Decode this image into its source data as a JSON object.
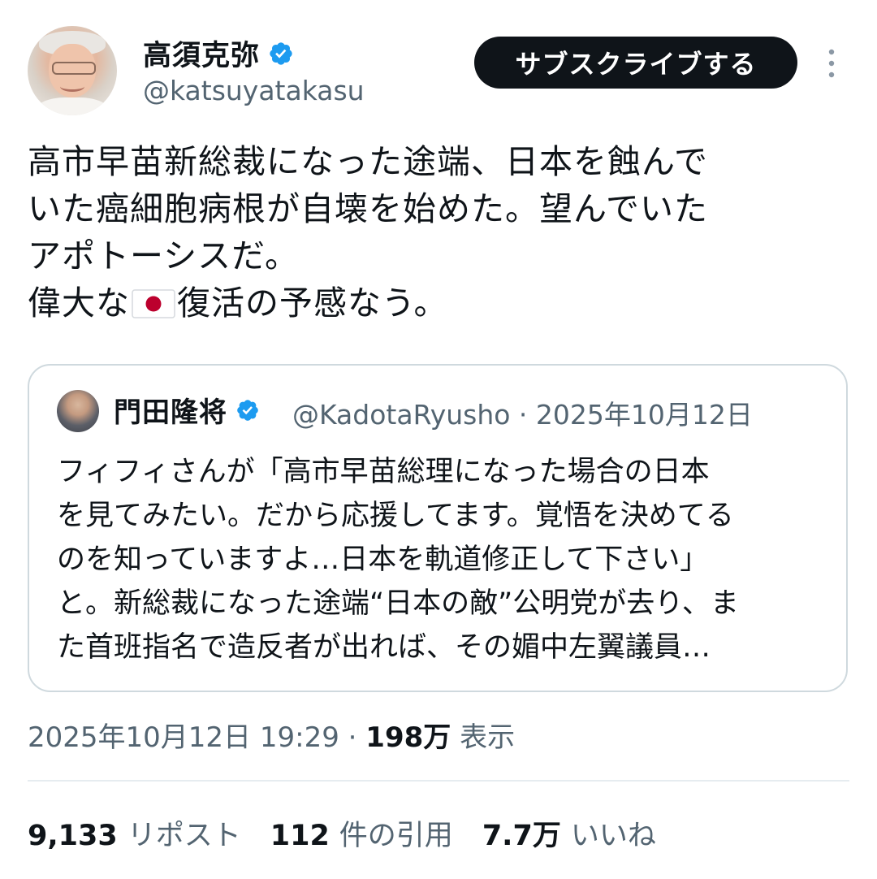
{
  "author": {
    "name": "高須克弥",
    "handle": "@katsuyatakasu"
  },
  "subscribe_label": "サブスクライブする",
  "tweet": {
    "line1": "高市早苗新総裁になった途端、日本を蝕んで",
    "line2": "いた癌細胞病根が自壊を始めた。望んでいた",
    "line3": "アポトーシスだ。",
    "line4_before_flag": "偉大な",
    "line4_after_flag": "復活の予感なう。"
  },
  "quote": {
    "name": "門田隆将",
    "meta": "@KadotaRyusho · 2025年10月12日",
    "text": "フィフィさんが「高市早苗総理になった場合の日本\nを見てみたい。だから応援してます。覚悟を決めてる\nのを知っていますよ…日本を軌道修正して下さい」\nと。新総裁になった途端“日本の敵”公明党が去り、ま\nた首班指名で造反者が出れば、その媚中左翼議員…"
  },
  "timestamp": "2025年10月12日 19:29 · ",
  "views_count": "198万",
  "views_label": " 表示",
  "stats": {
    "reposts_count": "9,133",
    "reposts_label": "リポスト",
    "quotes_count": "112",
    "quotes_label": "件の引用",
    "likes_count": "7.7万",
    "likes_label": "いいね"
  },
  "colors": {
    "verified": "#1d9bf0",
    "text_primary": "#0f1419",
    "text_secondary": "#536471",
    "button_bg": "#0f1419",
    "border": "#cfd9de"
  },
  "icons": [
    "verified-badge-icon",
    "more-options-icon",
    "japan-flag-icon"
  ]
}
